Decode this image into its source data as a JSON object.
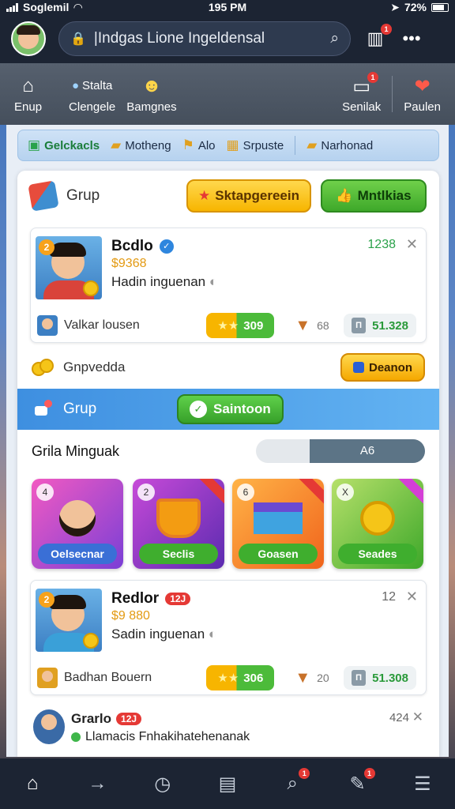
{
  "status_bar": {
    "carrier": "Soglemil",
    "time": "195 PM",
    "battery": "72%"
  },
  "top_bar": {
    "search_text": "|Indgas Lione Ingeldensal",
    "notif_badge": "1"
  },
  "sec_nav": {
    "items": [
      {
        "label": "Enup",
        "icon": "home-outline-icon"
      },
      {
        "label": "Clengele",
        "sub": "Stalta",
        "icon": "chat-icon"
      },
      {
        "label": "Bamgnes",
        "icon": "group-icon"
      }
    ],
    "right": [
      {
        "label": "Senilak",
        "icon": "window-icon",
        "badge": "1"
      },
      {
        "label": "Paulen",
        "icon": "gift-icon",
        "badge": ""
      }
    ]
  },
  "categories": [
    {
      "label": "Gelckacls",
      "icon": "box-icon",
      "active": true
    },
    {
      "label": "Motheng",
      "icon": "bag-icon",
      "active": false
    },
    {
      "label": "Alo",
      "icon": "flag-icon",
      "active": false
    },
    {
      "label": "Srpuste",
      "icon": "gift-icon",
      "active": false
    },
    {
      "label": "Narhonad",
      "icon": "bag-icon",
      "active": false
    }
  ],
  "group_row": {
    "label": "Grup",
    "yellow_btn": "Sktapgereein",
    "green_btn": "Mntlkias"
  },
  "posts": [
    {
      "name": "Bcdlo",
      "photo_num": "2",
      "price": "$9368",
      "subtitle": "Hadin inguenan",
      "count": "1238",
      "owner": "Valkar lousen",
      "score": "309",
      "views": "68",
      "money": "51.328"
    },
    {
      "name": "Redlor",
      "photo_num": "2",
      "tag": "12J",
      "price": "$9 880",
      "subtitle": "Sadin inguenan",
      "count": "12",
      "owner": "Badhan Bouern",
      "score": "306",
      "views": "20",
      "money": "51.308"
    }
  ],
  "coin_row": {
    "label": "Gnpvedda",
    "button": "Deanon"
  },
  "blue_band": {
    "label": "Grup",
    "button": "Saintoon"
  },
  "toggle_row": {
    "label": "Grila Minguak",
    "option": "A6"
  },
  "tiles": [
    {
      "label": "Oelsecnar",
      "corner": "4",
      "bg": "#d14bd6"
    },
    {
      "label": "Seclis",
      "corner": "2",
      "bg": "#8a3fd1"
    },
    {
      "label": "Goasen",
      "corner": "6",
      "bg": "#f08a1c"
    },
    {
      "label": "Seades",
      "corner": "X",
      "bg": "#8bc33a"
    }
  ],
  "last_row": {
    "name": "Grarlo",
    "tag": "12J",
    "message": "Llamacis Fnhakihatehenanak",
    "count": "424"
  },
  "bottom_nav": {
    "badges": [
      "1",
      "1"
    ]
  }
}
